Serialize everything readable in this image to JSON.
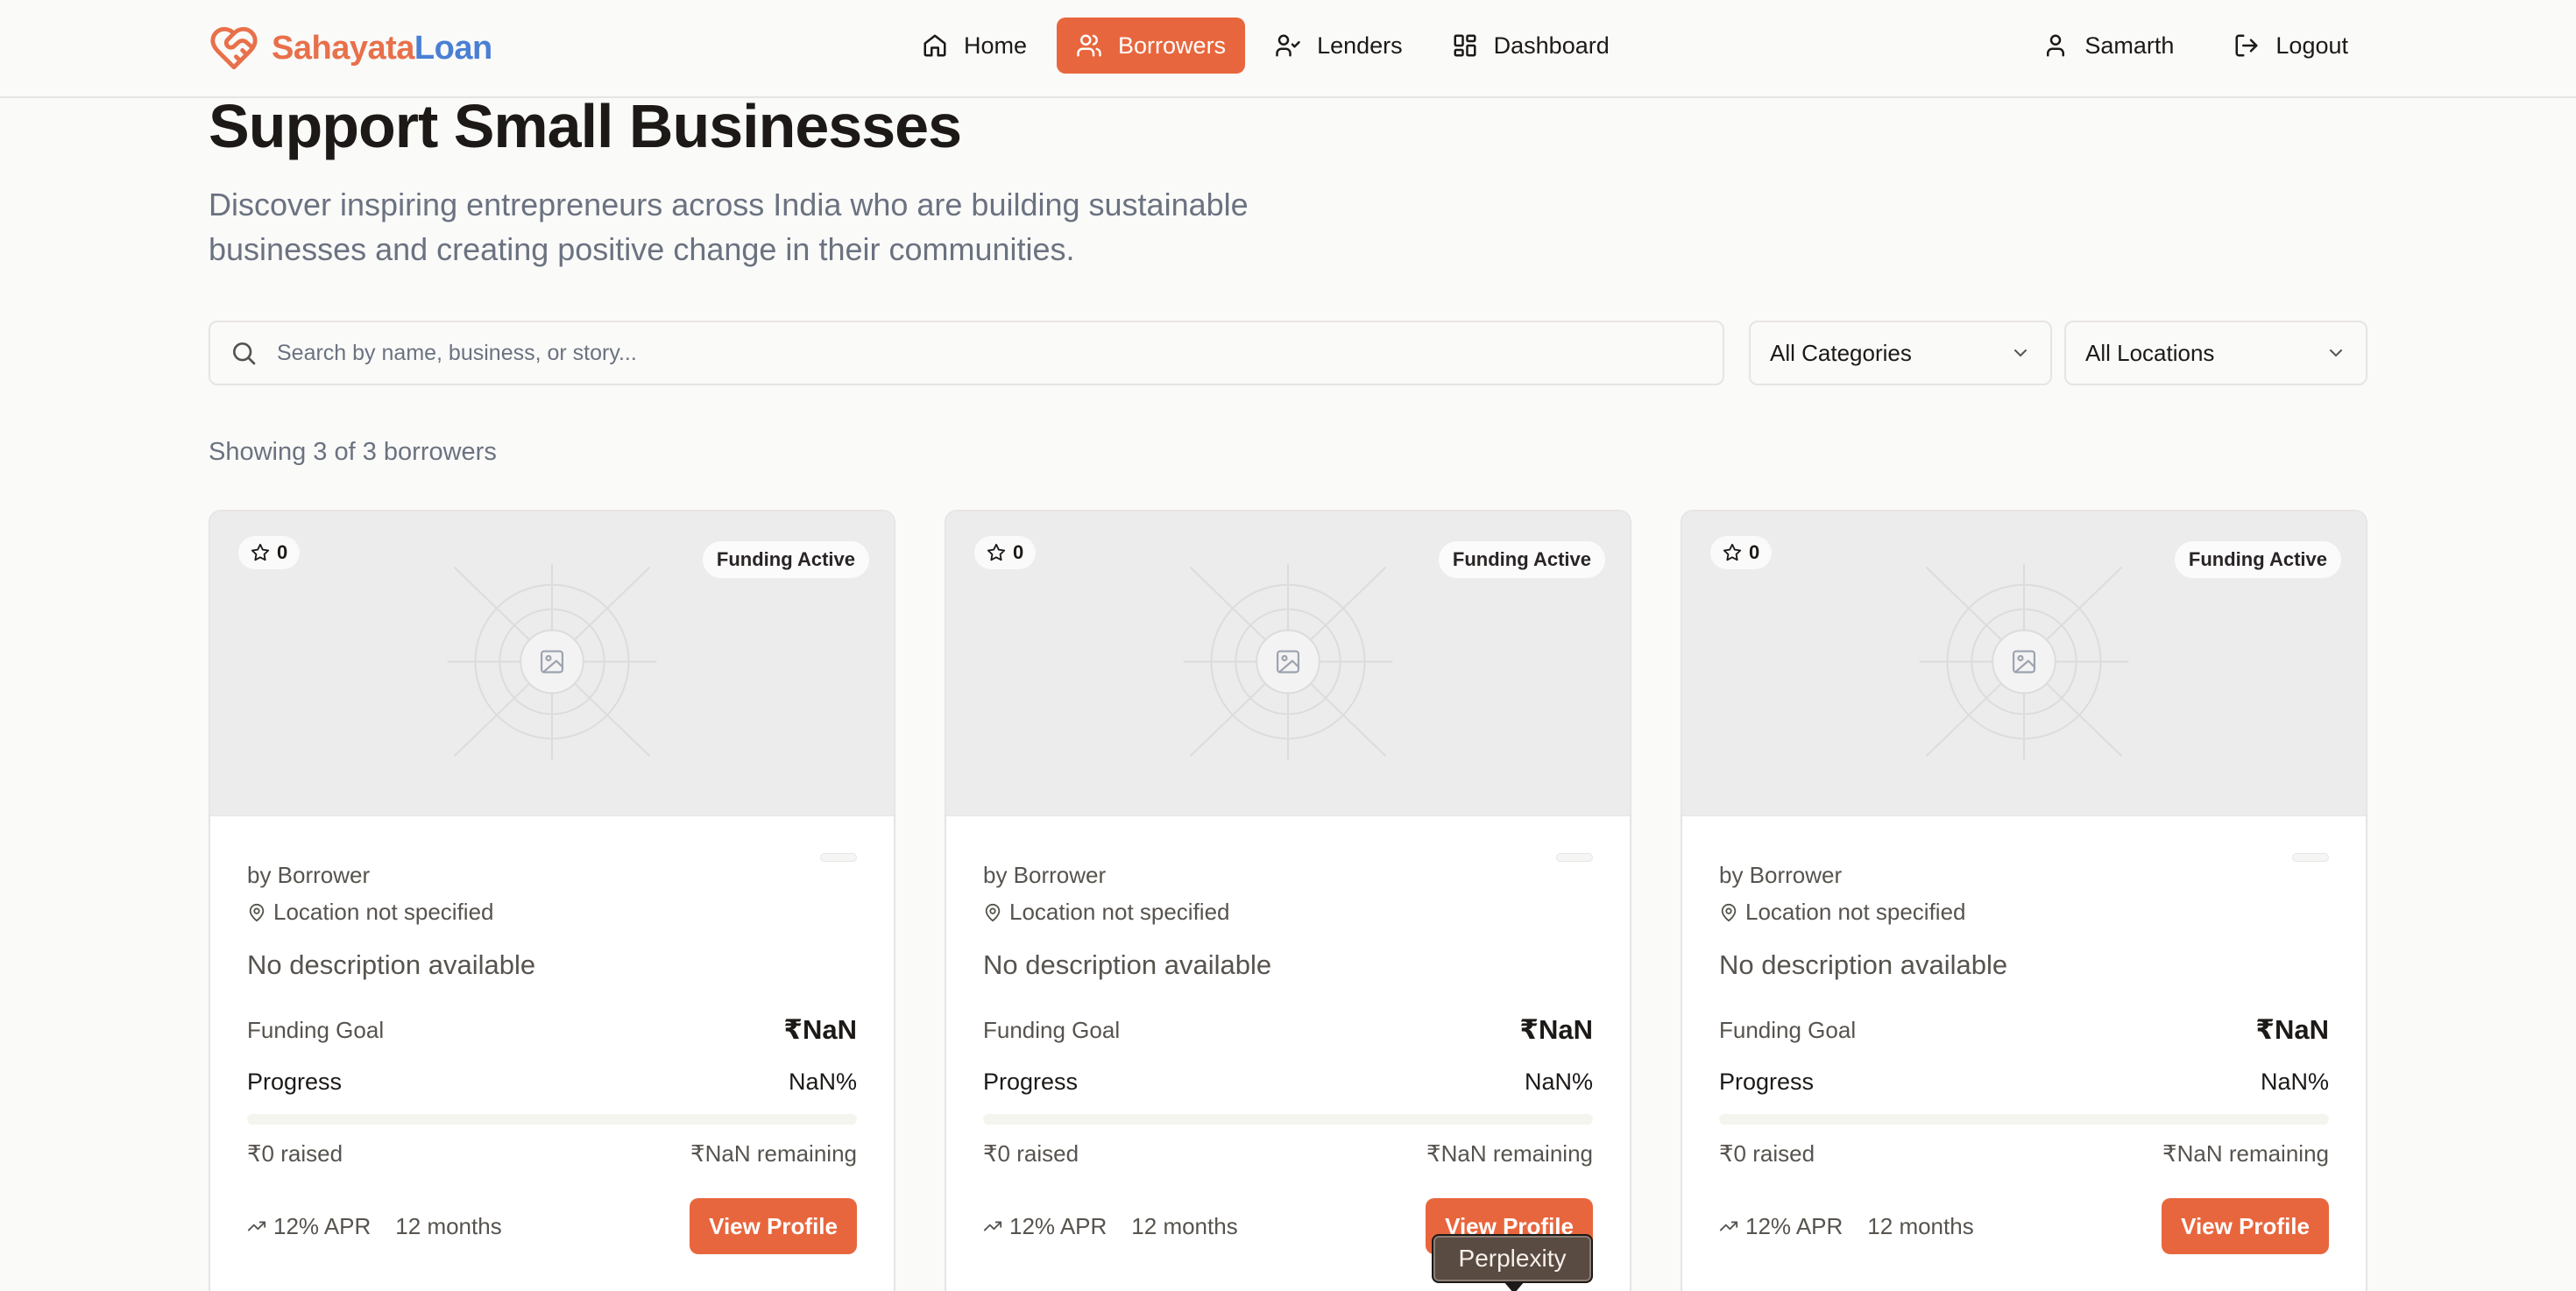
{
  "app": {
    "brand_part1": "Sahayata",
    "brand_part2": "Loan",
    "accent_color": "#e8663d",
    "brand_blue": "#4a7fd4"
  },
  "nav": {
    "items": [
      {
        "label": "Home",
        "icon": "home-icon",
        "active": false
      },
      {
        "label": "Borrowers",
        "icon": "users-icon",
        "active": true
      },
      {
        "label": "Lenders",
        "icon": "user-check-icon",
        "active": false
      },
      {
        "label": "Dashboard",
        "icon": "grid-icon",
        "active": false
      }
    ],
    "user_name": "Samarth",
    "logout_label": "Logout"
  },
  "hero": {
    "title": "Support Small Businesses",
    "subtitle": "Discover inspiring entrepreneurs across India who are building sustainable businesses and creating positive change in their communities."
  },
  "filters": {
    "search_placeholder": "Search by name, business, or story...",
    "search_value": "",
    "category_selected": "All Categories",
    "location_selected": "All Locations"
  },
  "results_text": "Showing 3 of 3 borrowers",
  "cards": [
    {
      "rating": "0",
      "status": "Funding Active",
      "by": "by Borrower",
      "location": "Location not specified",
      "description": "No description available",
      "funding_goal_label": "Funding Goal",
      "funding_goal": "₹NaN",
      "progress_label": "Progress",
      "progress": "NaN%",
      "progress_fraction": 0,
      "raised": "₹0 raised",
      "remaining": "₹NaN remaining",
      "apr": "12% APR",
      "term": "12 months",
      "button": "View Profile"
    },
    {
      "rating": "0",
      "status": "Funding Active",
      "by": "by Borrower",
      "location": "Location not specified",
      "description": "No description available",
      "funding_goal_label": "Funding Goal",
      "funding_goal": "₹NaN",
      "progress_label": "Progress",
      "progress": "NaN%",
      "progress_fraction": 0,
      "raised": "₹0 raised",
      "remaining": "₹NaN remaining",
      "apr": "12% APR",
      "term": "12 months",
      "button": "View Profile"
    },
    {
      "rating": "0",
      "status": "Funding Active",
      "by": "by Borrower",
      "location": "Location not specified",
      "description": "No description available",
      "funding_goal_label": "Funding Goal",
      "funding_goal": "₹NaN",
      "progress_label": "Progress",
      "progress": "NaN%",
      "progress_fraction": 0,
      "raised": "₹0 raised",
      "remaining": "₹NaN remaining",
      "apr": "12% APR",
      "term": "12 months",
      "button": "View Profile"
    }
  ],
  "tooltip": "Perplexity"
}
